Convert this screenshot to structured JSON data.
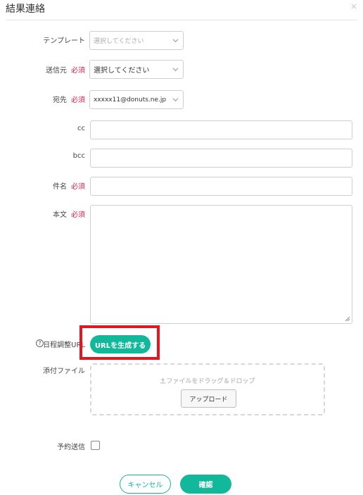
{
  "dialog": {
    "title": "結果連絡",
    "close_glyph": "×"
  },
  "form": {
    "template": {
      "label": "テンプレート",
      "value": "選択してください"
    },
    "sender": {
      "label": "送信元",
      "required": "必須",
      "value": "選択してください"
    },
    "recipient": {
      "label": "宛先",
      "required": "必須",
      "value": "xxxxx11@donuts.ne.jp"
    },
    "cc": {
      "label": "cc",
      "value": ""
    },
    "bcc": {
      "label": "bcc",
      "value": ""
    },
    "subject": {
      "label": "件名",
      "required": "必須",
      "value": ""
    },
    "body": {
      "label": "本文",
      "required": "必須",
      "value": ""
    },
    "schedule_url": {
      "label": "日程調整URL",
      "button": "URLを生成する",
      "help_glyph": "?"
    },
    "attachment": {
      "label": "添付ファイル",
      "drop_text": "ファイルをドラッグ＆ドロップ",
      "upload_button": "アップロード"
    },
    "scheduled_send": {
      "label": "予約送信",
      "checked": false
    }
  },
  "footer": {
    "cancel_label": "キャンセル",
    "confirm_label": "確認"
  },
  "colors": {
    "accent": "#12b89a",
    "required": "#e0224b",
    "highlight": "#e4161f"
  },
  "icons": [
    "close-icon",
    "chevron-down-icon",
    "help-icon",
    "upload-icon",
    "resize-grip-icon"
  ]
}
